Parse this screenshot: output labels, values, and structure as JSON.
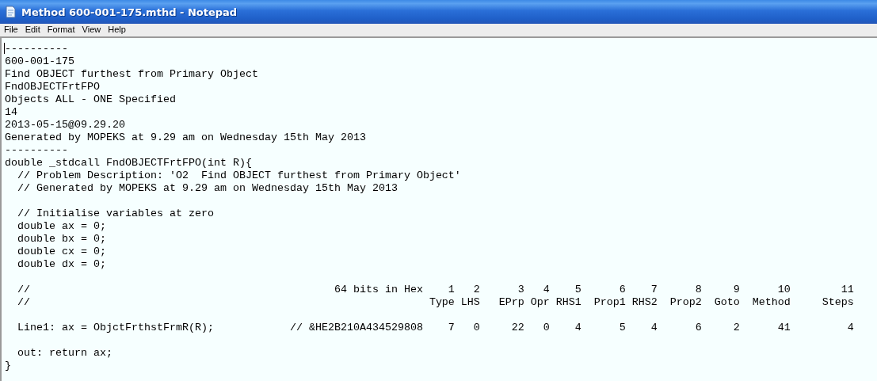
{
  "window": {
    "title": "Method 600-001-175.mthd - Notepad"
  },
  "menu": [
    "File",
    "Edit",
    "Format",
    "View",
    "Help"
  ],
  "blocks": [
    [
      "----------",
      "600-001-175",
      "Find OBJECT furthest from Primary Object",
      "FndOBJECTFrtFPO",
      "Objects ALL - ONE Specified",
      "14",
      "2013-05-15@09.29.20",
      "Generated by MOPEKS at 9.29 am on Wednesday 15th May 2013",
      "----------",
      "double _stdcall FndOBJECTFrtFPO(int R){",
      "  // Problem Description: 'O2  Find OBJECT furthest from Primary Object'",
      "  // Generated by MOPEKS at 9.29 am on Wednesday 15th May 2013"
    ],
    [
      "  // Initialise variables at zero",
      "  double ax = 0;",
      "  double bx = 0;",
      "  double cx = 0;",
      "  double dx = 0;"
    ],
    [
      "  //                                                64 bits in Hex    1   2      3   4    5      6    7      8     9      10        11",
      "  //                                                               Type LHS   EPrp Opr RHS1  Prop1 RHS2  Prop2  Goto  Method     Steps"
    ],
    [
      "  Line1: ax = ObjctFrthstFrmR(R);            // &HE2B210A434529808    7   0     22   0    4      5    4      6     2      41         4"
    ],
    [
      "  out: return ax;",
      "}"
    ]
  ]
}
